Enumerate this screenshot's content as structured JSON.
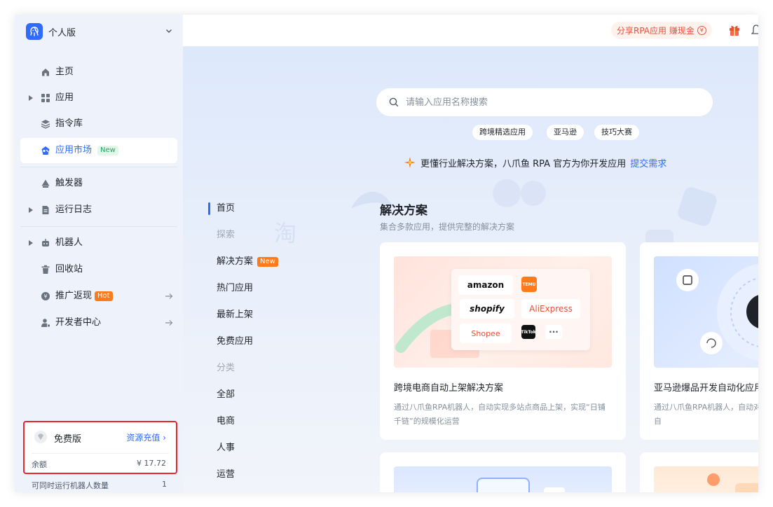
{
  "app": {
    "workspace": "个人版"
  },
  "sidebar": {
    "items": [
      {
        "label": "主页",
        "icon": "home-icon"
      },
      {
        "label": "应用",
        "icon": "grid-icon"
      },
      {
        "label": "指令库",
        "icon": "layers-icon"
      },
      {
        "label": "应用市场",
        "icon": "market-icon",
        "badge": "New",
        "active": true
      },
      {
        "label": "触发器",
        "icon": "trigger-icon"
      },
      {
        "label": "运行日志",
        "icon": "log-icon"
      },
      {
        "label": "机器人",
        "icon": "robot-icon"
      },
      {
        "label": "回收站",
        "icon": "trash-icon"
      },
      {
        "label": "推广返现",
        "icon": "coin-icon",
        "badge": "Hot"
      },
      {
        "label": "开发者中心",
        "icon": "developer-icon"
      }
    ],
    "plan": {
      "name": "免费版",
      "recharge": "资源充值 ›",
      "balance_label": "余额",
      "balance_value": "¥ 17.72",
      "concurrent_label": "可同时运行机器人数量",
      "concurrent_value": "1"
    }
  },
  "topbar": {
    "share_text": "分享RPA应用 赚现金",
    "yen": "¥"
  },
  "search": {
    "placeholder": "请输入应用名称搜索"
  },
  "chips": [
    "跨境精选应用",
    "亚马逊",
    "技巧大赛"
  ],
  "promo": {
    "text": "更懂行业解决方案，八爪鱼 RPA 官方为你开发应用",
    "link": "提交需求"
  },
  "category_nav": [
    {
      "label": "首页",
      "type": "active"
    },
    {
      "label": "探索",
      "type": "group"
    },
    {
      "label": "解决方案",
      "type": "normal",
      "badge": "New"
    },
    {
      "label": "热门应用",
      "type": "normal"
    },
    {
      "label": "最新上架",
      "type": "normal"
    },
    {
      "label": "免费应用",
      "type": "normal"
    },
    {
      "label": "分类",
      "type": "group"
    },
    {
      "label": "全部",
      "type": "normal"
    },
    {
      "label": "电商",
      "type": "normal"
    },
    {
      "label": "人事",
      "type": "normal"
    },
    {
      "label": "运营",
      "type": "normal"
    }
  ],
  "section": {
    "title": "解决方案",
    "subtitle": "集合多款应用，提供完整的解决方案"
  },
  "cards": [
    {
      "title": "跨境电商自动上架解决方案",
      "desc": "通过八爪鱼RPA机器人，自动实现多站点商品上架，实现“日铺千链”的规模化运营",
      "logos": [
        "amazon",
        "TEMU",
        "shopify",
        "AliExpress",
        "Shopee",
        "TikTok",
        "···"
      ]
    },
    {
      "title": "亚马逊爆品开发自动化应用",
      "desc": "通过八爪鱼RPA机器人，自动对亚洗、二次分析，实现选品评级自",
      "logo": "a"
    }
  ]
}
